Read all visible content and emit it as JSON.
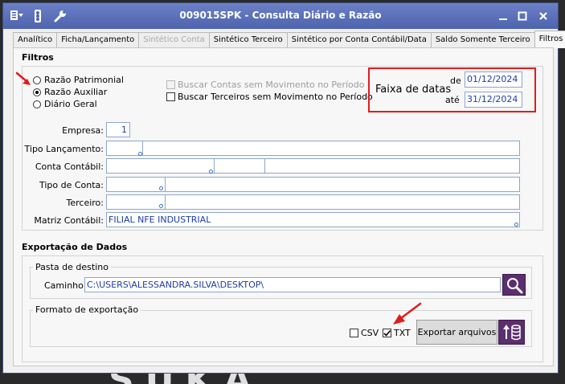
{
  "window": {
    "title": "009015SPK - Consulta Diário e Razão"
  },
  "tabs": [
    {
      "label": "Analítico"
    },
    {
      "label": "Ficha/Lançamento"
    },
    {
      "label": "Sintético Conta"
    },
    {
      "label": "Sintético Terceiro"
    },
    {
      "label": "Sintético por Conta Contábil/Data"
    },
    {
      "label": "Saldo Somente Terceiro"
    },
    {
      "label": "Filtros"
    }
  ],
  "filtros": {
    "title": "Filtros",
    "radios": [
      {
        "label": "Razão Patrimonial",
        "selected": false
      },
      {
        "label": "Razão Auxiliar",
        "selected": true
      },
      {
        "label": "Diário Geral",
        "selected": false
      }
    ],
    "checks": [
      {
        "label": "Buscar Contas sem Movimento no Período",
        "checked": false,
        "enabled": false
      },
      {
        "label": "Buscar Terceiros sem Movimento no Período",
        "checked": false,
        "enabled": true
      }
    ],
    "faixa": {
      "label": "Faixa de datas",
      "de_label": "de",
      "de_value": "01/12/2024",
      "ate_label": "até",
      "ate_value": "31/12/2024"
    },
    "empresa": {
      "label": "Empresa:",
      "value": "1"
    },
    "tipo_lancamento": {
      "label": "Tipo Lançamento:",
      "value": ""
    },
    "conta_contabil": {
      "label": "Conta Contábil:",
      "value": ""
    },
    "tipo_conta": {
      "label": "Tipo de Conta:",
      "value": ""
    },
    "terceiro": {
      "label": "Terceiro:",
      "value": ""
    },
    "matriz_contabil": {
      "label": "Matriz Contábil:",
      "value": "FILIAL NFE INDUSTRIAL"
    }
  },
  "exportacao": {
    "title": "Exportação de Dados",
    "pasta": {
      "legend": "Pasta de destino",
      "caminho_label": "Caminho:",
      "caminho_value": "C:\\USERS\\ALESSANDRA.SILVA\\DESKTOP\\"
    },
    "formato": {
      "legend": "Formato de exportação",
      "csv": {
        "label": "CSV",
        "checked": false
      },
      "txt": {
        "label": "TXT",
        "checked": true
      },
      "button_label": "Exportar arquivos"
    }
  },
  "colors": {
    "title_bar": "#5a6fbb",
    "accent_red": "#e11c1c",
    "field_text": "#1e3da8",
    "purple_button": "#5b2e6e"
  }
}
